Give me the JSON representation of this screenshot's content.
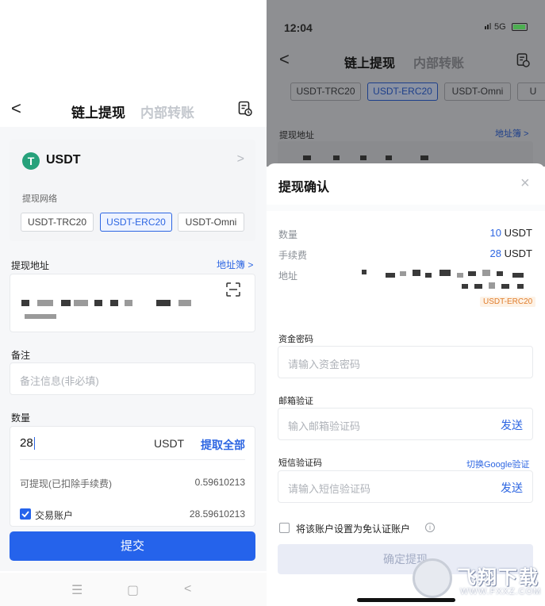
{
  "left": {
    "nav": {
      "back": "<",
      "tab_onchain": "链上提现",
      "tab_internal": "内部转账"
    },
    "coin": {
      "logo": "T",
      "name": "USDT",
      "arrow": ">"
    },
    "network": {
      "label": "提现网络",
      "options": [
        "USDT-TRC20",
        "USDT-ERC20",
        "USDT-Omni"
      ],
      "selected": "USDT-ERC20"
    },
    "address": {
      "label": "提现地址",
      "book_link": "地址簿 >"
    },
    "remark": {
      "label": "备注",
      "placeholder": "备注信息(非必填)"
    },
    "amount": {
      "label": "数量",
      "value": "28",
      "unit": "USDT",
      "withdraw_all": "提取全部",
      "available_label": "可提现(已扣除手续费)",
      "available_value": "0.59610213",
      "account_label": "交易账户",
      "account_value": "28.59610213"
    },
    "submit": "提交",
    "sys_nav": {
      "menu": "☰",
      "home": "▢",
      "back": "<"
    }
  },
  "right": {
    "status": {
      "time": "12:04",
      "network": "5G"
    },
    "nav": {
      "back": "<",
      "tab_onchain": "链上提现",
      "tab_internal": "内部转账"
    },
    "chips": [
      "USDT-TRC20",
      "USDT-ERC20",
      "USDT-Omni",
      "U"
    ],
    "address": {
      "label": "提现地址",
      "book_link": "地址簿 >"
    },
    "sheet": {
      "title": "提现确认",
      "close": "×",
      "amount_label": "数量",
      "amount_value": "10",
      "amount_unit": "USDT",
      "fee_label": "手续费",
      "fee_value": "28",
      "fee_unit": "USDT",
      "address_label": "地址",
      "network_badge": "USDT-ERC20",
      "fund_pwd_label": "资金密码",
      "fund_pwd_placeholder": "请输入资金密码",
      "email_label": "邮箱验证",
      "email_placeholder": "输入邮箱验证码",
      "email_send": "发送",
      "sms_label": "短信验证码",
      "sms_switch": "切换Google验证",
      "sms_placeholder": "请输入短信验证码",
      "sms_send": "发送",
      "trust_label": "将该账户设置为免认证账户",
      "info": "i",
      "confirm": "确定提现"
    }
  },
  "watermark": {
    "text": "飞翔下载",
    "sub": "WWW.FXXZ.COM"
  },
  "colors": {
    "primary": "#2563eb",
    "link": "#2d66e2",
    "tether": "#26a17b",
    "badge": "#e07c2a"
  }
}
